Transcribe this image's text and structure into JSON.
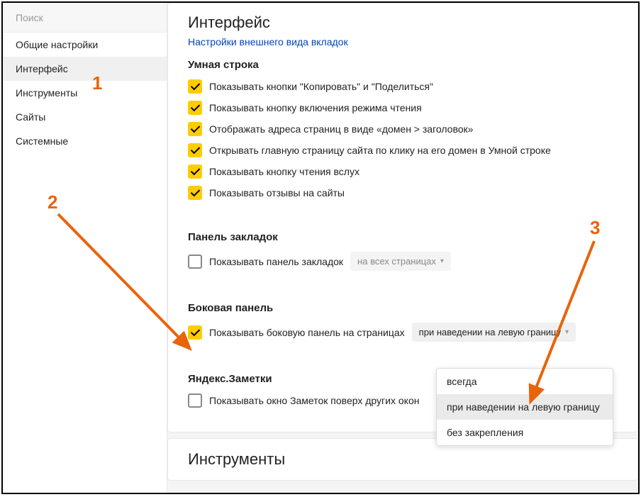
{
  "sidebar": {
    "search_placeholder": "Поиск",
    "items": [
      {
        "label": "Общие настройки"
      },
      {
        "label": "Интерфейс"
      },
      {
        "label": "Инструменты"
      },
      {
        "label": "Сайты"
      },
      {
        "label": "Системные"
      }
    ]
  },
  "main": {
    "title": "Интерфейс",
    "top_link": "Настройки внешнего вида вкладок",
    "sections": {
      "smartline": {
        "title": "Умная строка",
        "options": [
          "Показывать кнопки \"Копировать\" и \"Поделиться\"",
          "Показывать кнопку включения режима чтения",
          "Отображать адреса страниц в виде «домен > заголовок»",
          "Открывать главную страницу сайта по клику на его домен в Умной строке",
          "Показывать кнопку чтения вслух",
          "Показывать отзывы на сайты"
        ]
      },
      "bookmarks": {
        "title": "Панель закладок",
        "option": "Показывать панель закладок",
        "select_value": "на всех страницах"
      },
      "sidepanel": {
        "title": "Боковая панель",
        "option": "Показывать боковую панель на страницах",
        "select_value": "при наведении на левую границу",
        "dropdown_options": [
          "всегда",
          "при наведении на левую границу",
          "без закрепления"
        ]
      },
      "notes": {
        "title": "Яндекс.Заметки",
        "option": "Показывать окно Заметок поверх других окон"
      }
    },
    "tools_title": "Инструменты"
  },
  "annotations": {
    "n1": "1",
    "n2": "2",
    "n3": "3"
  }
}
